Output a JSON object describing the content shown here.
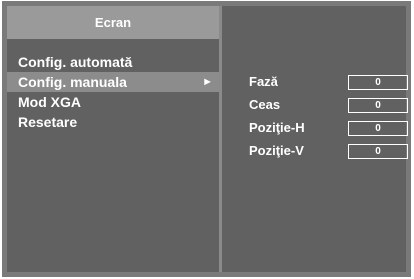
{
  "menu": {
    "title": "Ecran",
    "items": [
      {
        "label": "Config. automată"
      },
      {
        "label": "Config. manuala",
        "arrow": "►"
      },
      {
        "label": "Mod XGA"
      },
      {
        "label": "Resetare"
      }
    ]
  },
  "settings": [
    {
      "label": "Fază",
      "value": "0"
    },
    {
      "label": "Ceas",
      "value": "0"
    },
    {
      "label": "Poziţie-H",
      "value": "0"
    },
    {
      "label": "Poziţie-V",
      "value": "0"
    }
  ],
  "colors": {
    "background": "#616161",
    "title_bar": "#9a9a9a",
    "highlight": "#8c8c8c"
  }
}
